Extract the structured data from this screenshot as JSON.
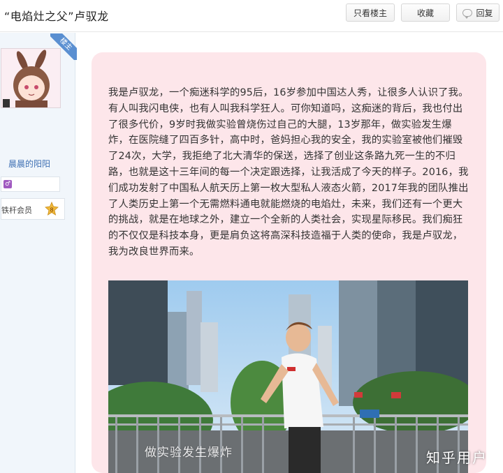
{
  "header": {
    "title": "“电焰灶之父”卢驭龙",
    "only_op_label": "只看楼主",
    "favorite_label": "收藏",
    "reply_label": "回复"
  },
  "author": {
    "badge": "楼主",
    "username": "晨晨的阳阳",
    "member_title": "铁杆会员",
    "level": "8"
  },
  "post": {
    "text": "我是卢驭龙，一个痴迷科学的95后，16岁参加中国达人秀，让很多人认识了我。有人叫我闪电侠，也有人叫我科学狂人。可你知道吗，这痴迷的背后，我也付出了很多代价，9岁时我做实验曾烧伤过自己的大腿，13岁那年，做实验发生爆炸，在医院缝了四百多针，高中时，爸妈担心我的安全，我的实验室被他们摧毁了24次，大学，我拒绝了北大清华的保送，选择了创业这条路九死一生的不归路，也就是这十三年间的每一个决定跟选择，让我活成了今天的样子。2016，我们成功发射了中国私人航天历上第一枚大型私人液态火箭，2017年我的团队推出了人类历史上第一个无需燃料通电就能燃烧的电焰灶，未来，我们还有一个更大的挑战，就是在地球之外，建立一个全新的人类社会，实现星际移民。我们痴狂的不仅仅是科技本身，更是肩负这将高深科技造福于人类的使命，我是卢驭龙，我为改良世界而来。",
    "image_caption": "做实验发生爆炸"
  },
  "watermark": "知乎用户",
  "colors": {
    "bubble": "#fde6ea",
    "sidebar": "#f1f6fb",
    "link": "#3d6fb3",
    "ribbon": "#5a8fd1"
  }
}
